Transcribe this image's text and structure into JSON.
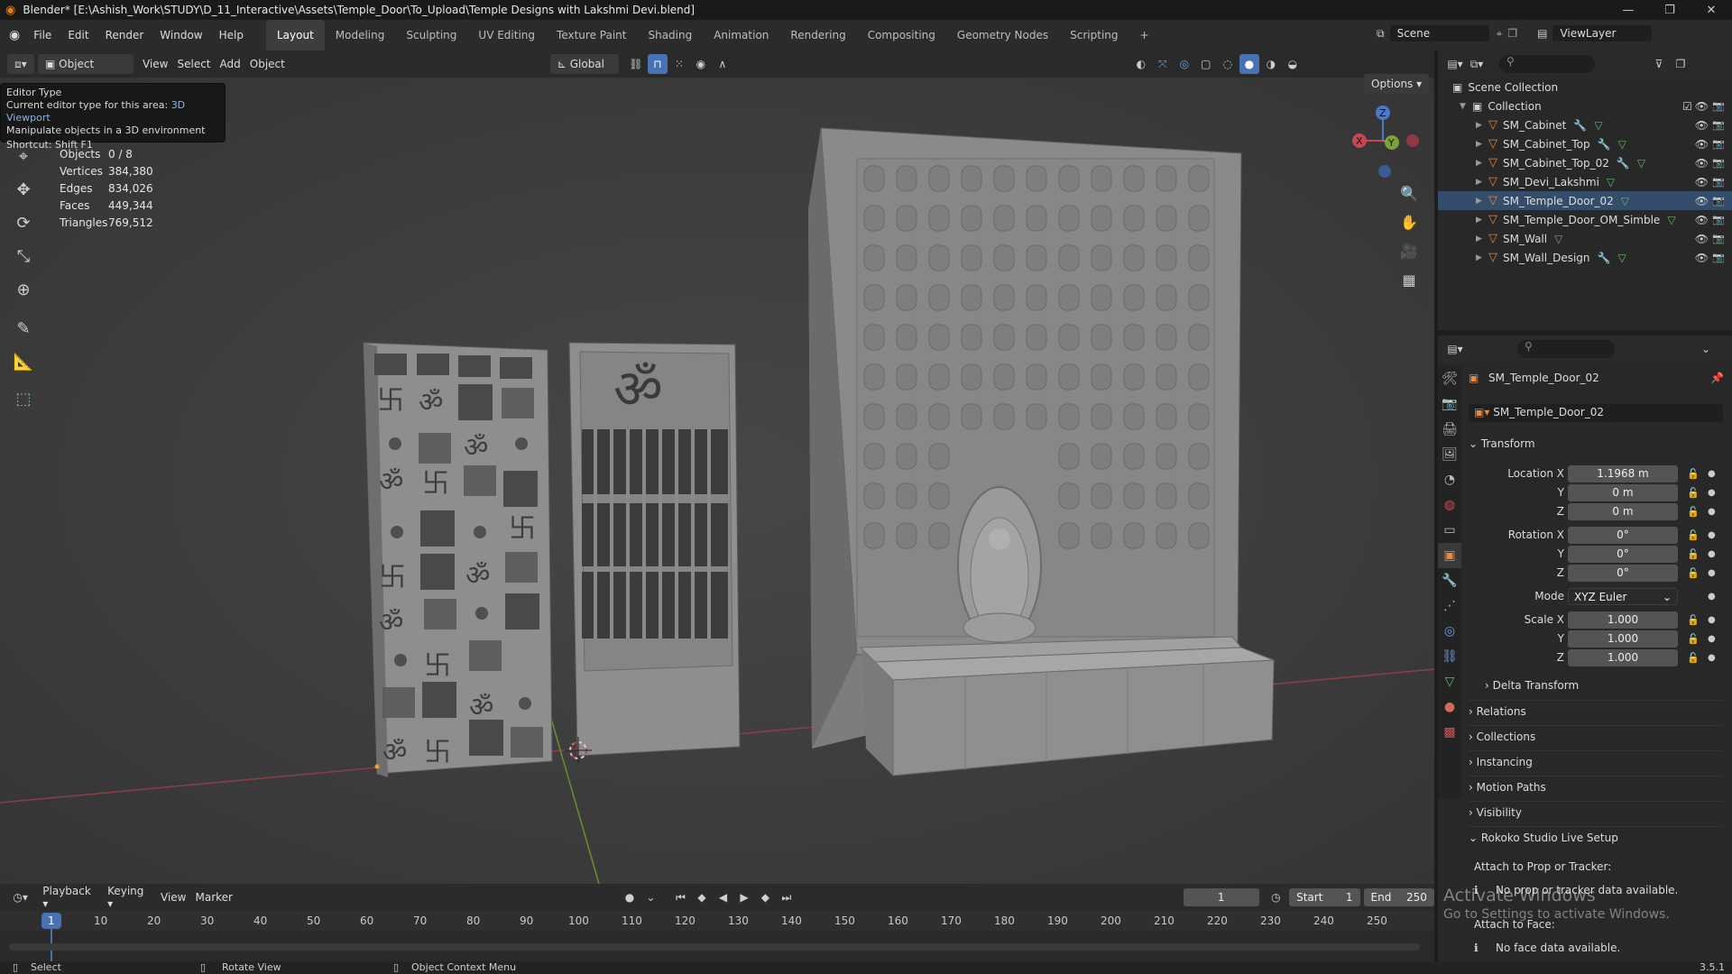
{
  "window": {
    "title": "Blender* [E:\\Ashish_Work\\STUDY\\D_11_Interactive\\Assets\\Temple_Door\\To_Upload\\Temple Designs with Lakshmi Devi.blend]"
  },
  "menu": [
    "File",
    "Edit",
    "Render",
    "Window",
    "Help"
  ],
  "workspaces": [
    "Layout",
    "Modeling",
    "Sculpting",
    "UV Editing",
    "Texture Paint",
    "Shading",
    "Animation",
    "Rendering",
    "Compositing",
    "Geometry Nodes",
    "Scripting"
  ],
  "active_workspace": "Layout",
  "scene": {
    "name": "Scene",
    "view_layer": "ViewLayer"
  },
  "viewport_header": {
    "mode": "Object Mode",
    "menus": [
      "View",
      "Select",
      "Add",
      "Object"
    ],
    "orientation": "Global",
    "options": "Options"
  },
  "tooltip": {
    "title": "Editor Type",
    "line1_prefix": "Current editor type for this area:",
    "line1_value": "3D Viewport",
    "line2": "Manipulate objects in a 3D environment",
    "shortcut": "Shortcut: Shift F1"
  },
  "stats": [
    {
      "k": "Objects",
      "v": "0 / 8"
    },
    {
      "k": "Vertices",
      "v": "384,380"
    },
    {
      "k": "Edges",
      "v": "834,026"
    },
    {
      "k": "Faces",
      "v": "449,344"
    },
    {
      "k": "Triangles",
      "v": "769,512"
    }
  ],
  "outliner": {
    "root": "Scene Collection",
    "collection": "Collection",
    "items": [
      {
        "name": "SM_Cabinet"
      },
      {
        "name": "SM_Cabinet_Top"
      },
      {
        "name": "SM_Cabinet_Top_02"
      },
      {
        "name": "SM_Devi_Lakshmi"
      },
      {
        "name": "SM_Temple_Door_02"
      },
      {
        "name": "SM_Temple_Door_OM_Simble"
      },
      {
        "name": "SM_Wall"
      },
      {
        "name": "SM_Wall_Design"
      }
    ]
  },
  "properties": {
    "object_name": "SM_Temple_Door_02",
    "data_name": "SM_Temple_Door_02",
    "transform_label": "Transform",
    "location_label": "Location X",
    "rotation_label": "Rotation X",
    "scale_label": "Scale X",
    "y_label": "Y",
    "z_label": "Z",
    "location": [
      "1.1968 m",
      "0 m",
      "0 m"
    ],
    "rotation": [
      "0°",
      "0°",
      "0°"
    ],
    "mode_label": "Mode",
    "mode": "XYZ Euler",
    "scale": [
      "1.000",
      "1.000",
      "1.000"
    ],
    "delta": "Delta Transform",
    "panels": [
      "Relations",
      "Collections",
      "Instancing",
      "Motion Paths",
      "Visibility"
    ],
    "rokoko": "Rokoko Studio Live Setup",
    "attach_prop": "Attach to Prop or Tracker:",
    "no_prop": "No prop or tracker data available.",
    "attach_face": "Attach to Face:",
    "no_face": "No face data available."
  },
  "watermark": {
    "line1": "Activate Windows",
    "line2": "Go to Settings to activate Windows."
  },
  "timeline": {
    "menus": [
      "Playback",
      "Keying",
      "View",
      "Marker"
    ],
    "current_frame": "1",
    "start_label": "Start",
    "start": "1",
    "end_label": "End",
    "end": "250",
    "ticks": [
      "1",
      "10",
      "20",
      "30",
      "40",
      "50",
      "60",
      "70",
      "80",
      "90",
      "100",
      "110",
      "120",
      "130",
      "140",
      "150",
      "160",
      "170",
      "180",
      "190",
      "200",
      "210",
      "220",
      "230",
      "240",
      "250"
    ]
  },
  "statusbar": {
    "select": "Select",
    "rotate": "Rotate View",
    "context": "Object Context Menu",
    "version": "3.5.1"
  }
}
